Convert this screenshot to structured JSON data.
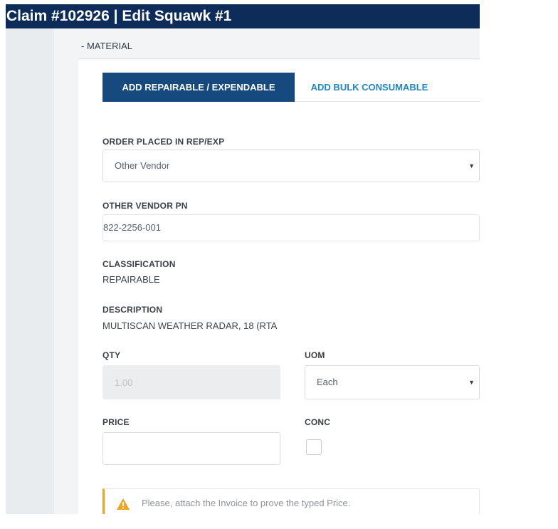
{
  "header": {
    "title": "Claim #102926 | Edit Squawk #1"
  },
  "section": {
    "label": "- MATERIAL"
  },
  "tabs": [
    {
      "label": "ADD REPAIRABLE / EXPENDABLE",
      "active": true
    },
    {
      "label": "ADD BULK CONSUMABLE",
      "active": false
    }
  ],
  "form": {
    "order_placed": {
      "label": "ORDER PLACED IN REP/EXP",
      "value": "Other Vendor"
    },
    "other_vendor_pn": {
      "label": "OTHER VENDOR PN",
      "value": "822-2256-001"
    },
    "classification": {
      "label": "CLASSIFICATION",
      "value": "REPAIRABLE"
    },
    "description": {
      "label": "DESCRIPTION",
      "value": "MULTISCAN WEATHER RADAR, 18 (RTA"
    },
    "qty": {
      "label": "QTY",
      "value": "1.00"
    },
    "uom": {
      "label": "UOM",
      "value": "Each"
    },
    "price": {
      "label": "PRICE",
      "value": ""
    },
    "conc": {
      "label": "CONC",
      "checked": false
    }
  },
  "alert": {
    "message": "Please, attach the Invoice to prove the typed Price."
  },
  "colors": {
    "header_bg": "#0e2c5a",
    "active_tab_bg": "#164a7e",
    "link_blue": "#1f86c9",
    "warning": "#f0a31f"
  },
  "icons": {
    "select_arrow": "caret-down-icon",
    "alert": "warning-triangle-icon"
  }
}
